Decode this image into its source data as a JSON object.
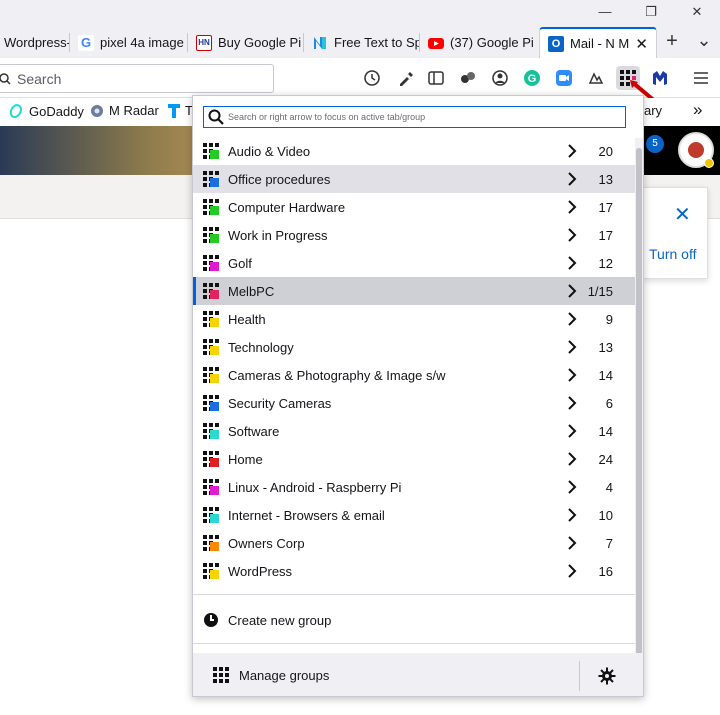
{
  "window": {
    "restore_glyph": "❐",
    "close_glyph": "✕",
    "minimize_glyph": "—"
  },
  "tabs": [
    {
      "title": "Wordpress-",
      "favicon": "wordpress-icon"
    },
    {
      "title": "pixel 4a image",
      "favicon": "google-icon"
    },
    {
      "title": "Buy Google Pi",
      "favicon": "hn-icon",
      "badge": "HN"
    },
    {
      "title": "Free Text to Sp",
      "favicon": "naturalreader-icon"
    },
    {
      "title": "(37) Google Pi",
      "favicon": "youtube-icon"
    },
    {
      "title": "Mail - N M",
      "favicon": "outlook-icon",
      "badge": "O",
      "active": true
    }
  ],
  "newtab_glyph": "+",
  "tablist_glyph": "⌄",
  "toolbar": {
    "search_placeholder": "Search",
    "overflow_glyph": "»"
  },
  "bookmarks": [
    {
      "label": "GoDaddy",
      "icon": "godaddy-icon"
    },
    {
      "label": "M Radar",
      "icon": "radar-icon"
    },
    {
      "label": "T",
      "icon": "telstra-icon"
    },
    {
      "label": "ary",
      "icon": ""
    }
  ],
  "page": {
    "badge": "5",
    "card_action": "Turn off"
  },
  "panel": {
    "search_placeholder": "Search or right arrow to focus on active tab/group",
    "groups": [
      {
        "name": "Audio & Video",
        "count": "20",
        "color": "#22cc22"
      },
      {
        "name": "Office procedures",
        "count": "13",
        "color": "#1a6fe0"
      },
      {
        "name": "Computer Hardware",
        "count": "17",
        "color": "#22cc22"
      },
      {
        "name": "Work in Progress",
        "count": "17",
        "color": "#22cc22"
      },
      {
        "name": "Golf",
        "count": "12",
        "color": "#e21ad0"
      },
      {
        "name": "MelbPC",
        "count": "1/15",
        "color": "#e0245e"
      },
      {
        "name": "Health",
        "count": "9",
        "color": "#f5d400"
      },
      {
        "name": "Technology",
        "count": "13",
        "color": "#f5d400"
      },
      {
        "name": "Cameras & Photography & Image s/w",
        "count": "14",
        "color": "#f5d400"
      },
      {
        "name": "Security Cameras",
        "count": "6",
        "color": "#1a6fe0"
      },
      {
        "name": "Software",
        "count": "14",
        "color": "#2ad9d0"
      },
      {
        "name": "Home",
        "count": "24",
        "color": "#e02020"
      },
      {
        "name": "Linux - Android - Raspberry Pi",
        "count": "4",
        "color": "#e21ad0"
      },
      {
        "name": "Internet - Browsers & email",
        "count": "10",
        "color": "#2ad9d0"
      },
      {
        "name": "Owners Corp",
        "count": "7",
        "color": "#ff8a00"
      },
      {
        "name": "WordPress",
        "count": "16",
        "color": "#f5d400"
      }
    ],
    "create_label": "Create new group",
    "manage_label": "Manage groups"
  },
  "colors": {
    "accent": "#0060df",
    "selected_row": "#cfcfd6",
    "hover_row": "#e0e0e6"
  }
}
